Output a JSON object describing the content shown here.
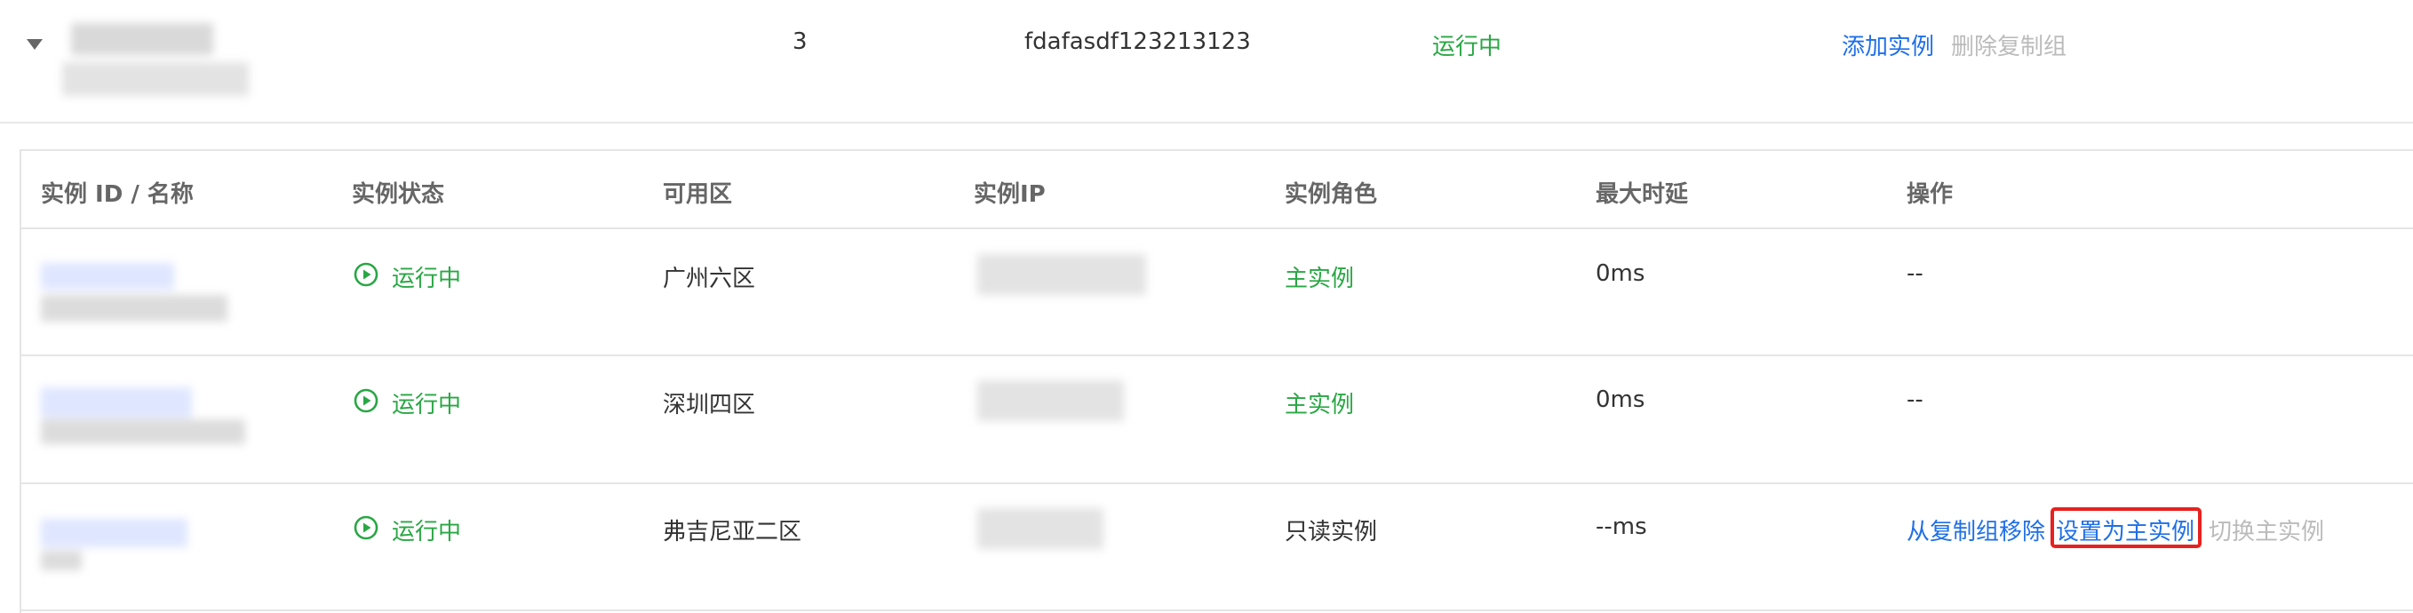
{
  "group": {
    "count": "3",
    "group_id": "fdafasdf123213123",
    "status": "运行中",
    "actions": {
      "add_instance": "添加实例",
      "delete_group": "删除复制组"
    }
  },
  "table": {
    "headers": {
      "id_name": "实例 ID / 名称",
      "status": "实例状态",
      "zone": "可用区",
      "ip": "实例IP",
      "role": "实例角色",
      "max_delay": "最大时延",
      "actions": "操作"
    },
    "rows": [
      {
        "status": "运行中",
        "zone": "广州六区",
        "role": "主实例",
        "delay": "0ms",
        "action_placeholder": "--"
      },
      {
        "status": "运行中",
        "zone": "深圳四区",
        "role": "主实例",
        "delay": "0ms",
        "action_placeholder": "--"
      },
      {
        "status": "运行中",
        "zone": "弗吉尼亚二区",
        "role": "只读实例",
        "delay": "--ms",
        "actions": {
          "remove_from_group": "从复制组移除",
          "set_as_primary": "设置为主实例",
          "switch_primary": "切换主实例"
        }
      }
    ]
  },
  "colors": {
    "running_green": "#29a744",
    "link_blue": "#1f6fe8",
    "disabled_gray": "#bbbbbb",
    "highlight_red": "#e7211f"
  },
  "icons": {
    "expand": "caret-down-icon",
    "status": "play-circle-icon"
  }
}
